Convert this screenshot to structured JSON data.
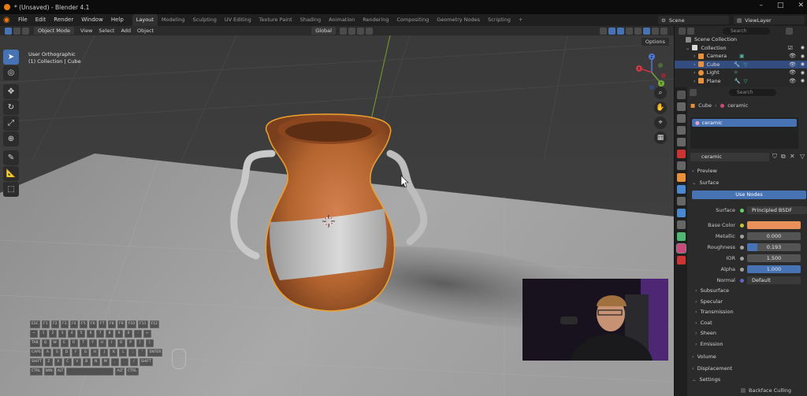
{
  "window": {
    "title": "* (Unsaved) - Blender 4.1"
  },
  "menus": [
    "File",
    "Edit",
    "Render",
    "Window",
    "Help"
  ],
  "workspace_tabs": [
    "Layout",
    "Modeling",
    "Sculpting",
    "UV Editing",
    "Texture Paint",
    "Shading",
    "Animation",
    "Rendering",
    "Compositing",
    "Geometry Nodes",
    "Scripting"
  ],
  "active_workspace": "Layout",
  "scene": {
    "label": "Scene",
    "view_layer": "ViewLayer"
  },
  "viewport_header": {
    "mode": "Object Mode",
    "menus": [
      "View",
      "Select",
      "Add",
      "Object"
    ],
    "transform_orientation": "Global",
    "options_label": "Options"
  },
  "viewport": {
    "view_name": "User Orthographic",
    "collection_info": "(1) Collection | Cube"
  },
  "gizmo": {
    "x": "X",
    "y": "Y",
    "z": "Z"
  },
  "keyboard": {
    "rows": [
      [
        "ESC",
        "F1",
        "F2",
        "F3",
        "F4",
        "F5",
        "F6",
        "F7",
        "F8",
        "F9",
        "F10",
        "F11",
        "F12"
      ],
      [
        "~",
        "1",
        "2",
        "3",
        "4",
        "5",
        "6",
        "7",
        "8",
        "9",
        "0",
        "-",
        "←"
      ],
      [
        "TAB",
        "Q",
        "W",
        "E",
        "R",
        "T",
        "Y",
        "U",
        "I",
        "O",
        "P",
        "[",
        "]"
      ],
      [
        "CAPS",
        "A",
        "S",
        "D",
        "F",
        "G",
        "H",
        "J",
        "K",
        "L",
        ";",
        "'",
        "ENTER"
      ],
      [
        "SHIFT",
        "Z",
        "X",
        "C",
        "V",
        "B",
        "N",
        "M",
        ",",
        ".",
        "/",
        "SHIFT"
      ],
      [
        "CTRL",
        "WIN",
        "ALT",
        "",
        "ALT",
        "CTRL"
      ]
    ]
  },
  "outliner": {
    "search_placeholder": "Search",
    "items": [
      {
        "label": "Scene Collection",
        "indent": 0,
        "selected": false
      },
      {
        "label": "Collection",
        "indent": 1,
        "selected": false
      },
      {
        "label": "Camera",
        "indent": 2,
        "selected": false
      },
      {
        "label": "Cube",
        "indent": 2,
        "selected": true
      },
      {
        "label": "Light",
        "indent": 2,
        "selected": false
      },
      {
        "label": "Plane",
        "indent": 2,
        "selected": false
      }
    ]
  },
  "properties": {
    "search_placeholder": "Search",
    "breadcrumb": {
      "object": "Cube",
      "material": "ceramic"
    },
    "material_slot": "ceramic",
    "material_name": "ceramic",
    "preview_label": "Preview",
    "surface_section": "Surface",
    "use_nodes_label": "Use Nodes",
    "surface_label": "Surface",
    "surface_value": "Principled BSDF",
    "fields": [
      {
        "label": "Base Color",
        "value": "",
        "color": "#e8915a"
      },
      {
        "label": "Metallic",
        "value": "0.000",
        "fill": 0.0
      },
      {
        "label": "Roughness",
        "value": "0.193",
        "fill": 0.193
      },
      {
        "label": "IOR",
        "value": "1.500",
        "fill": 0.0
      },
      {
        "label": "Alpha",
        "value": "1.000",
        "fill": 1.0
      }
    ],
    "normal_label": "Normal",
    "normal_value": "Default",
    "subsections": [
      "Subsurface",
      "Specular",
      "Transmission",
      "Coat",
      "Sheen",
      "Emission"
    ],
    "sections": [
      "Volume",
      "Displacement",
      "Settings"
    ],
    "backface_culling": "Backface Culling"
  },
  "colors": {
    "accent": "#4772b3",
    "selection_outline": "#f0a02c",
    "vase_clay": "#b8683a",
    "active_tab": "#e87d0d"
  }
}
